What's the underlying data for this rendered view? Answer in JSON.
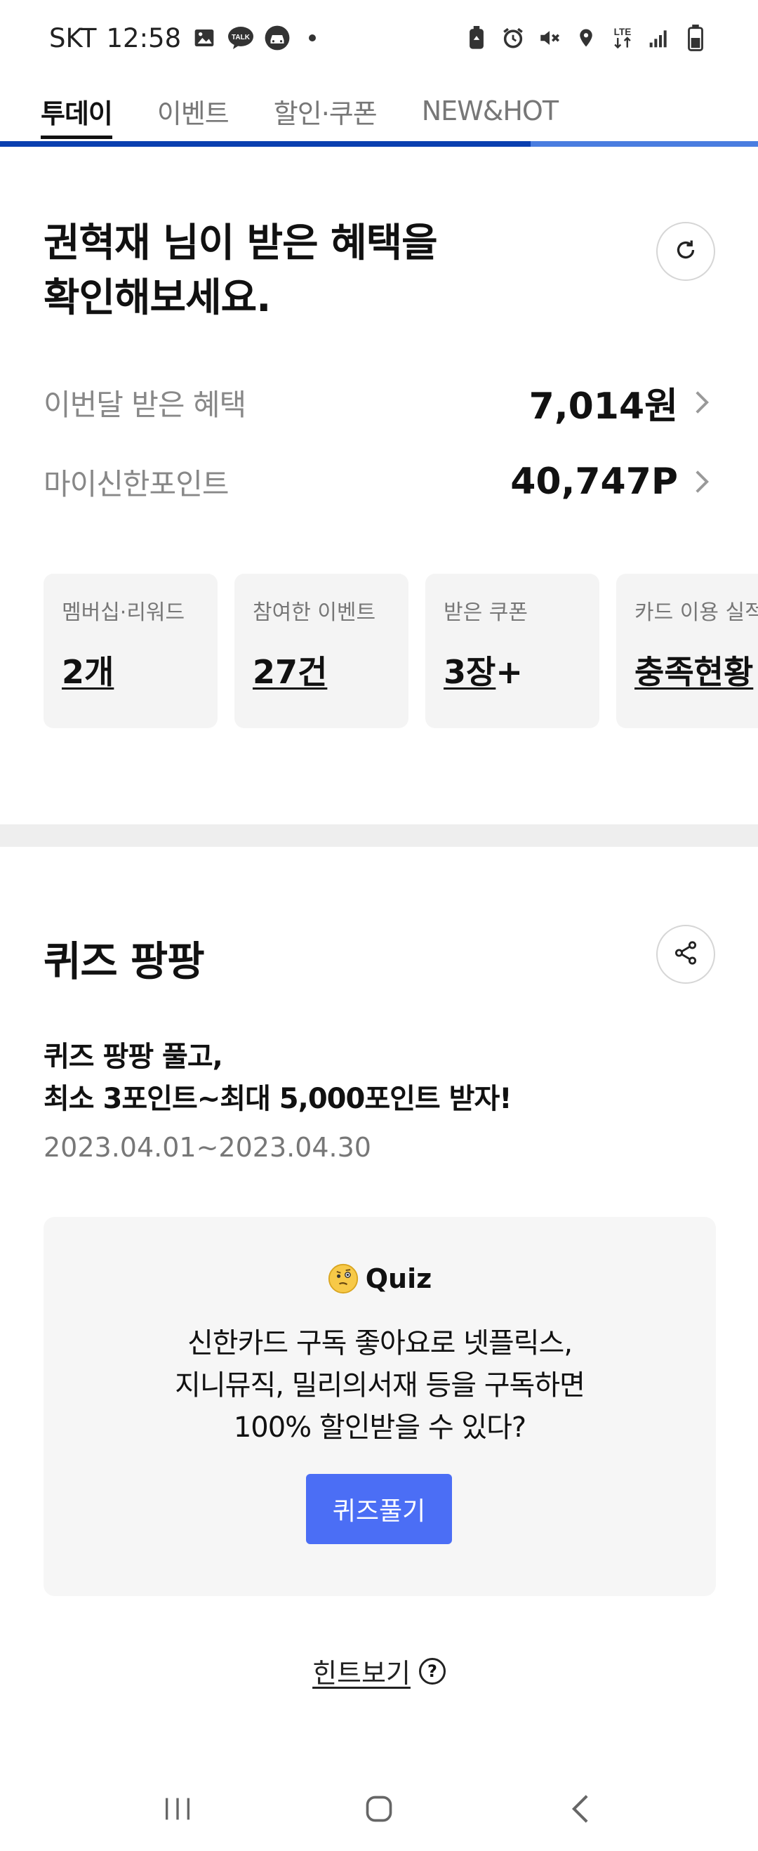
{
  "status_bar": {
    "carrier": "SKT",
    "time": "12:58",
    "network": "LTE"
  },
  "tabs": [
    {
      "label": "투데이",
      "active": true
    },
    {
      "label": "이벤트",
      "active": false
    },
    {
      "label": "할인·쿠폰",
      "active": false
    },
    {
      "label": "NEW&HOT",
      "active": false
    }
  ],
  "tab_progress": 0.7,
  "benefits": {
    "title_line1": "권혁재 님이 받은 혜택을",
    "title_line2": "확인해보세요.",
    "monthly_label": "이번달 받은 혜택",
    "monthly_value": "7,014원",
    "points_label": "마이신한포인트",
    "points_value": "40,747P"
  },
  "summary_cards": [
    {
      "label": "멤버십·리워드",
      "value": "2개",
      "suffix": ""
    },
    {
      "label": "참여한 이벤트",
      "value": "27건",
      "suffix": ""
    },
    {
      "label": "받은 쿠폰",
      "value": "3장",
      "suffix": "+"
    },
    {
      "label": "카드 이용 실적",
      "value": "충족현황",
      "suffix": ""
    }
  ],
  "quiz": {
    "section_title": "퀴즈 팡팡",
    "headline_line1": "퀴즈 팡팡 풀고,",
    "headline_line2": "최소 3포인트~최대 5,000포인트 받자!",
    "period": "2023.04.01~2023.04.30",
    "label": "Quiz",
    "question_line1": "신한카드 구독 좋아요로 넷플릭스,",
    "question_line2": "지니뮤직, 밀리의서재 등을 구독하면",
    "question_line3": "100% 할인받을 수 있다?",
    "button_label": "퀴즈풀기",
    "hint_label": "힌트보기",
    "hint_icon_text": "?"
  },
  "colors": {
    "accent_blue": "#4b6ef5",
    "progress_dark": "#0a3fb0",
    "progress_light": "#4a7de0"
  }
}
